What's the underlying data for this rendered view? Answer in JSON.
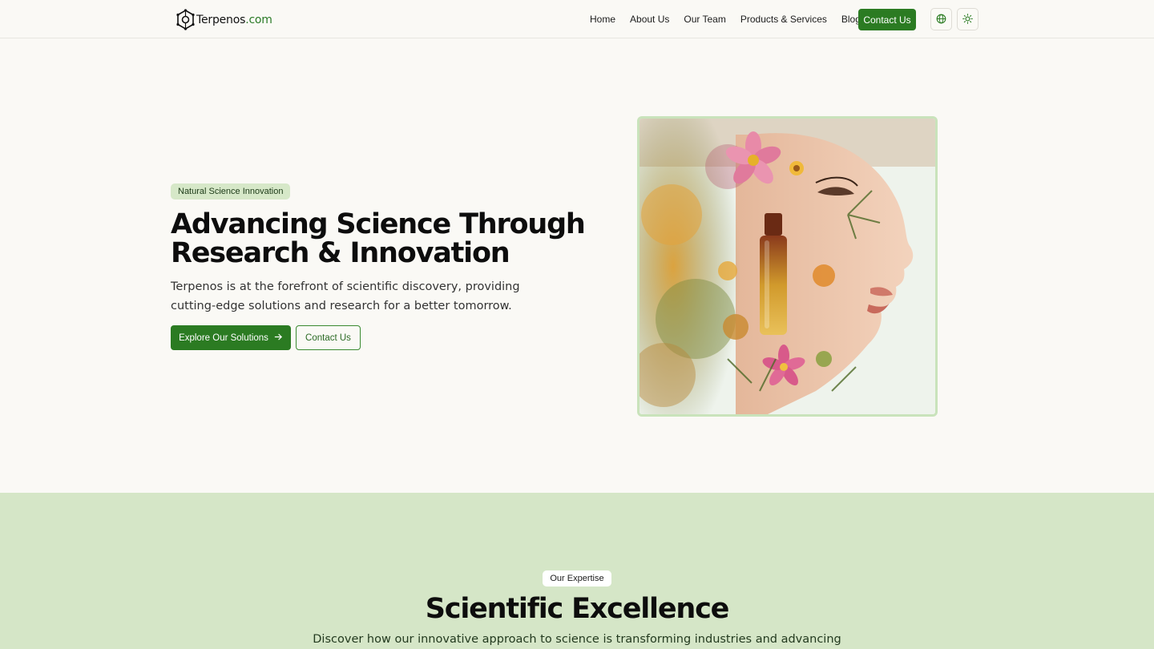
{
  "header": {
    "logo": {
      "name": "Terpenos",
      "tld": ".com",
      "icon": "hexagon-molecule-icon"
    },
    "nav": [
      {
        "label": "Home"
      },
      {
        "label": "About Us"
      },
      {
        "label": "Our Team"
      },
      {
        "label": "Products & Services"
      },
      {
        "label": "Blog"
      }
    ],
    "contact_label": "Contact Us",
    "language_icon": "globe-icon",
    "theme_icon": "sun-icon"
  },
  "hero": {
    "badge": "Natural Science Innovation",
    "title_line1": "Advancing Science Through",
    "title_line2": "Research & Innovation",
    "subtitle_line1": "Terpenos is at the forefront of scientific discovery, providing",
    "subtitle_line2": "cutting-edge solutions and research for a better tomorrow.",
    "primary_button": "Explore Our Solutions",
    "primary_button_icon": "arrow-right-icon",
    "secondary_button": "Contact Us",
    "image_subject": "woman profile with flowers and perfume bottle"
  },
  "expertise": {
    "badge": "Our Expertise",
    "title": "Scientific Excellence",
    "subtitle": "Discover how our innovative approach to science is transforming industries and advancing"
  },
  "colors": {
    "brand_green": "#2b7b22",
    "badge_bg": "#d6e8c8",
    "section_bg": "#d5e6c7",
    "page_bg": "#faf9f5",
    "image_border": "#c9e3bb"
  }
}
